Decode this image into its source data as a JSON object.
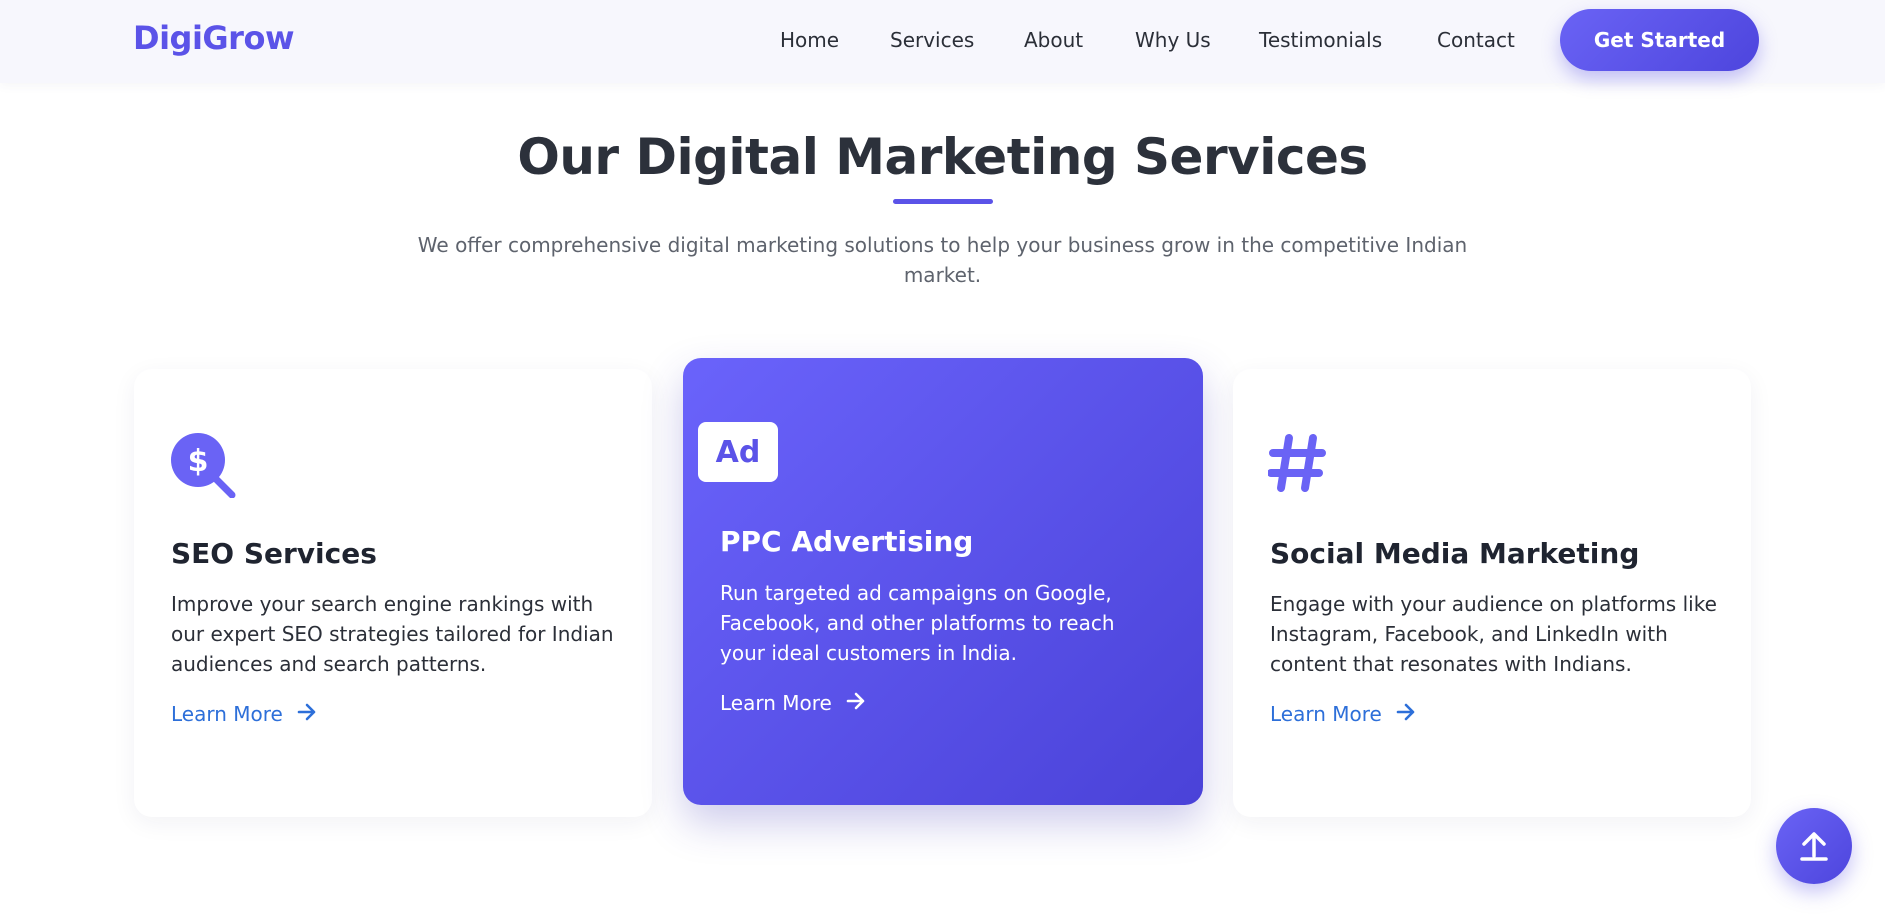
{
  "nav": {
    "logo": "DigiGrow",
    "links": [
      "Home",
      "Services",
      "About",
      "Why Us",
      "Testimonials",
      "Contact"
    ],
    "cta": "Get Started"
  },
  "section": {
    "title": "Our Digital Marketing Services",
    "subtitle": "We offer comprehensive digital marketing solutions to help your business grow in the competitive Indian market."
  },
  "services": [
    {
      "icon": "seo-search-dollar-icon",
      "title": "SEO Services",
      "description": "Improve your search engine rankings with our expert SEO strategies tailored for Indian audiences and search patterns.",
      "link": "Learn More"
    },
    {
      "icon": "ad-icon",
      "icon_text": "Ad",
      "title": "PPC Advertising",
      "description": "Run targeted ad campaigns on Google, Facebook, and other platforms to reach your ideal customers in India.",
      "link": "Learn More"
    },
    {
      "icon": "hashtag-icon",
      "title": "Social Media Marketing",
      "description": "Engage with your audience on platforms like Instagram, Facebook, and LinkedIn with content that resonates with Indians.",
      "link": "Learn More"
    }
  ],
  "colors": {
    "accent": "#5b53e8",
    "link": "#2d6fd9",
    "heading": "#2c313b"
  }
}
